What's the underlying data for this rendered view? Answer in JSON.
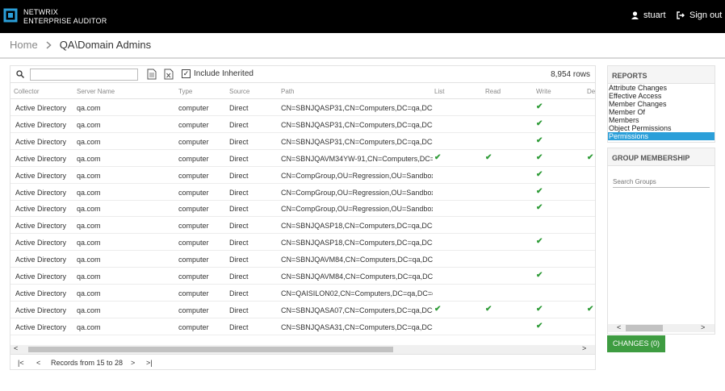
{
  "app": {
    "brand_line1": "NETWRIX",
    "brand_line2": "ENTERPRISE AUDITOR",
    "user_name": "stuart",
    "signout_label": "Sign out"
  },
  "breadcrumb": {
    "home": "Home",
    "current": "QA\\Domain Admins"
  },
  "toolbar": {
    "search_value": "",
    "include_inherited_label": "Include Inherited",
    "include_inherited_checked": true,
    "row_count": "8,954 rows"
  },
  "table": {
    "columns": [
      "Collector",
      "Server Name",
      "Type",
      "Source",
      "Path",
      "List",
      "Read",
      "Write",
      "De"
    ],
    "rows": [
      [
        "Active Directory",
        "qa.com",
        "computer",
        "Direct",
        "CN=SBNJQASP31,CN=Computers,DC=qa,DC=",
        "",
        "",
        "✔",
        ""
      ],
      [
        "Active Directory",
        "qa.com",
        "computer",
        "Direct",
        "CN=SBNJQASP31,CN=Computers,DC=qa,DC=",
        "",
        "",
        "✔",
        ""
      ],
      [
        "Active Directory",
        "qa.com",
        "computer",
        "Direct",
        "CN=SBNJQASP31,CN=Computers,DC=qa,DC=",
        "",
        "",
        "✔",
        ""
      ],
      [
        "Active Directory",
        "qa.com",
        "computer",
        "Direct",
        "CN=SBNJQAVM34YW-91,CN=Computers,DC=",
        "✔",
        "✔",
        "✔",
        "✔"
      ],
      [
        "Active Directory",
        "qa.com",
        "computer",
        "Direct",
        "CN=CompGroup,OU=Regression,OU=Sandbox",
        "",
        "",
        "✔",
        ""
      ],
      [
        "Active Directory",
        "qa.com",
        "computer",
        "Direct",
        "CN=CompGroup,OU=Regression,OU=Sandbox",
        "",
        "",
        "✔",
        ""
      ],
      [
        "Active Directory",
        "qa.com",
        "computer",
        "Direct",
        "CN=CompGroup,OU=Regression,OU=Sandbox",
        "",
        "",
        "✔",
        ""
      ],
      [
        "Active Directory",
        "qa.com",
        "computer",
        "Direct",
        "CN=SBNJQASP18,CN=Computers,DC=qa,DC=",
        "",
        "",
        "",
        ""
      ],
      [
        "Active Directory",
        "qa.com",
        "computer",
        "Direct",
        "CN=SBNJQASP18,CN=Computers,DC=qa,DC=",
        "",
        "",
        "✔",
        ""
      ],
      [
        "Active Directory",
        "qa.com",
        "computer",
        "Direct",
        "CN=SBNJQAVM84,CN=Computers,DC=qa,DC",
        "",
        "",
        "",
        ""
      ],
      [
        "Active Directory",
        "qa.com",
        "computer",
        "Direct",
        "CN=SBNJQAVM84,CN=Computers,DC=qa,DC",
        "",
        "",
        "✔",
        ""
      ],
      [
        "Active Directory",
        "qa.com",
        "computer",
        "Direct",
        "CN=QAISILON02,CN=Computers,DC=qa,DC=c",
        "",
        "",
        "",
        ""
      ],
      [
        "Active Directory",
        "qa.com",
        "computer",
        "Direct",
        "CN=SBNJQASA07,CN=Computers,DC=qa,DC=",
        "✔",
        "✔",
        "✔",
        "✔"
      ],
      [
        "Active Directory",
        "qa.com",
        "computer",
        "Direct",
        "CN=SBNJQASA31,CN=Computers,DC=qa,DC=",
        "",
        "",
        "✔",
        ""
      ]
    ]
  },
  "pager": {
    "records_label": "Records from 15 to 28"
  },
  "reports": {
    "title": "REPORTS",
    "items": [
      "Attribute Changes",
      "Effective Access",
      "Member Changes",
      "Member Of",
      "Members",
      "Object Permissions",
      "Permissions"
    ],
    "active_index": 6
  },
  "group_membership": {
    "title": "GROUP MEMBERSHIP",
    "search_placeholder": "Search Groups"
  },
  "changes_button": "CHANGES (0)",
  "colors": {
    "topbar": "#000000",
    "accent": "#2b9fd9",
    "check": "#2e9b37",
    "changes_button": "#3e9c41"
  },
  "icons": {
    "logo": "netrix-logo-icon",
    "user": "user-icon",
    "signout": "signout-icon",
    "search": "search-icon",
    "export_csv": "document-icon",
    "export_excel": "excel-icon",
    "check": "check-icon"
  }
}
